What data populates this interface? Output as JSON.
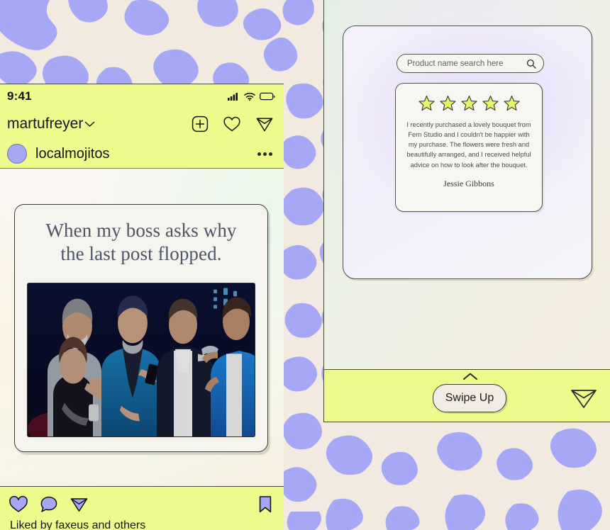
{
  "theme": {
    "lime": "#EEFB8C",
    "periwinkle": "#A7A8F5",
    "cream": "#F2E9E1",
    "ink": "#14140f"
  },
  "phone": {
    "status": {
      "time": "9:41",
      "icons": [
        "signal-bars-icon",
        "wifi-icon",
        "battery-icon"
      ]
    },
    "appbar": {
      "handle": "martufreyer",
      "chevron": "chevron-down-icon",
      "actions": [
        "plus-box-icon",
        "heart-icon",
        "send-icon"
      ]
    },
    "post_user": {
      "username": "localmojitos",
      "avatar": "avatar",
      "more": "more-options-icon"
    },
    "post": {
      "headline_line1": "When my boss asks why",
      "headline_line2": "the last post flopped.",
      "image_alt": "stage-photo"
    },
    "actions": {
      "like": "heart-icon",
      "comment": "comment-icon",
      "share": "send-icon",
      "save": "bookmark-icon"
    },
    "liked_by": "Liked by faxeus and others"
  },
  "story": {
    "search": {
      "placeholder": "Product name search here",
      "icon": "search-icon"
    },
    "review": {
      "rating": 5,
      "stars_icon": "star-icon",
      "text": "I recently purchased a lovely bouquet from Fern Studio and I couldn't be happier with my purchase. The flowers were fresh and beautifully arranged, and I received helpful advice on how to look after the bouquet.",
      "author": "Jessie Gibbons"
    },
    "footer": {
      "swipe_label": "Swipe Up",
      "chevron": "chevron-up-icon",
      "send": "send-icon"
    }
  }
}
